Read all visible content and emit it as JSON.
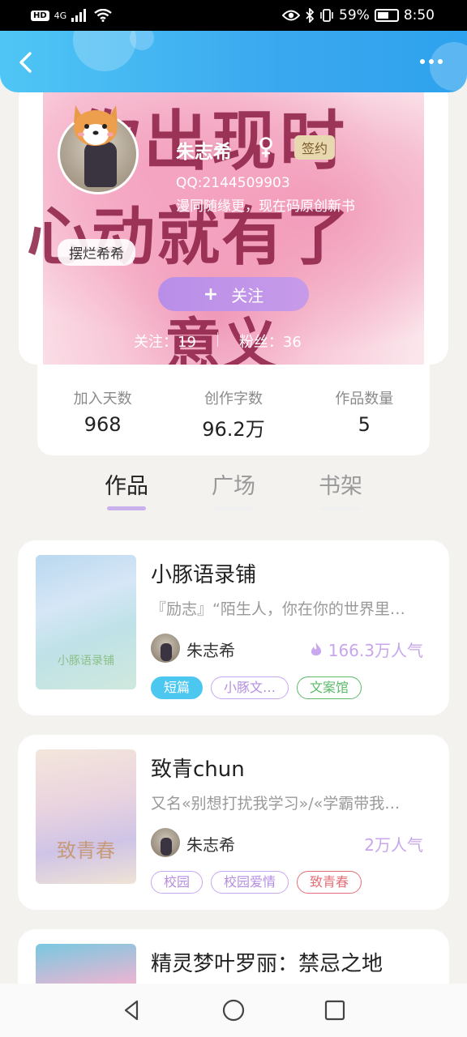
{
  "status": {
    "left": [
      "HD",
      "4G"
    ],
    "battery_percent": "59%",
    "time": "8:50",
    "battery_level": 0.59
  },
  "appbar": {
    "back_icon": "back-chevron-icon",
    "more_icon": "more-dots-icon"
  },
  "profile": {
    "name": "朱志希",
    "gender_icon": "female-icon",
    "sign_badge": "签约",
    "qq": "QQ:2144509903",
    "bio": "漫同随缘更，现在码原创新书",
    "badge_name": "摆烂希希",
    "follow_label": "关注",
    "follow_prefix": "+",
    "following_text": "关注：19",
    "fans_text": "粉丝：36",
    "background_calligraphy": [
      "你出现时",
      "心动就有了",
      "意义"
    ]
  },
  "stats": [
    {
      "label": "加入天数",
      "value": "968"
    },
    {
      "label": "创作字数",
      "value": "96.2万"
    },
    {
      "label": "作品数量",
      "value": "5"
    }
  ],
  "tabs": [
    {
      "label": "作品",
      "active": true
    },
    {
      "label": "广场",
      "active": false
    },
    {
      "label": "书架",
      "active": false
    }
  ],
  "books": [
    {
      "title": "小豚语录铺",
      "desc": "『励志』“陌生人，你在你的世界里…",
      "author": "朱志希",
      "popularity": "166.3万人气",
      "hot": true,
      "cover_text": "小豚语录铺",
      "tags": [
        {
          "label": "短篇",
          "style": "filled-blue"
        },
        {
          "label": "小豚文…",
          "style": "outline-purple"
        },
        {
          "label": "文案馆",
          "style": "outline-green"
        }
      ]
    },
    {
      "title": "致青chun",
      "desc": "又名«别想打扰我学习»/«学霸带我…",
      "author": "朱志希",
      "popularity": "2万人气",
      "hot": false,
      "cover_text": "致青春",
      "tags": [
        {
          "label": "校园",
          "style": "outline-purple"
        },
        {
          "label": "校园爱情",
          "style": "outline-purple"
        },
        {
          "label": "致青春",
          "style": "outline-red"
        }
      ]
    },
    {
      "title": "精灵梦叶罗丽：禁忌之地",
      "desc": "",
      "author": "",
      "popularity": "",
      "hot": false,
      "cover_text": "",
      "tags": []
    }
  ],
  "colors": {
    "accent_purple": "#c9b2ec",
    "appbar_blue": "#3aa8ef",
    "tag_blue": "#4cc8f0",
    "tag_green": "#5cb86a",
    "tag_red": "#e27078"
  },
  "navbar": {
    "icons": [
      "back-triangle-icon",
      "home-circle-icon",
      "recents-square-icon"
    ]
  }
}
